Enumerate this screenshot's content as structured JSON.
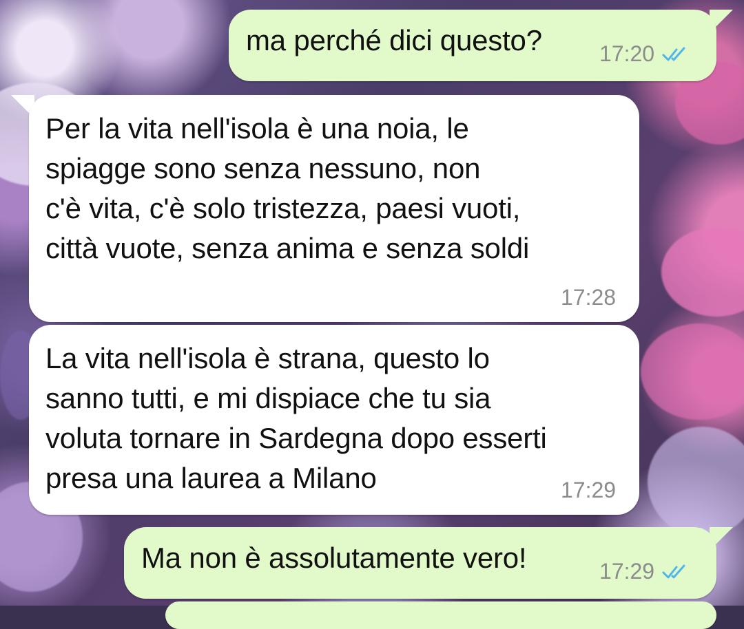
{
  "chat": {
    "messages": [
      {
        "direction": "outgoing",
        "text": "ma perché dici questo?",
        "time": "17:20",
        "status": "read"
      },
      {
        "direction": "incoming",
        "text": "Per la vita nell'isola è una noia, le\nspiagge sono senza nessuno, non\nc'è vita, c'è solo tristezza, paesi vuoti,\ncittà vuote, senza anima e senza soldi",
        "time": "17:28"
      },
      {
        "direction": "incoming",
        "text": "La vita nell'isola è strana, questo lo\nsanno tutti, e mi dispiace che tu sia\nvoluta tornare in Sardegna dopo esserti\npresa una laurea a Milano",
        "time": "17:29"
      },
      {
        "direction": "outgoing",
        "text": "Ma non è assolutamente vero!",
        "time": "17:29",
        "status": "read"
      }
    ]
  },
  "colors": {
    "outgoing_bubble": "#e2f9c9",
    "incoming_bubble": "#ffffff",
    "time_text": "#8c8c8c",
    "read_ticks": "#4fb6ec"
  },
  "icons": {
    "read_status": "double-check-icon"
  }
}
